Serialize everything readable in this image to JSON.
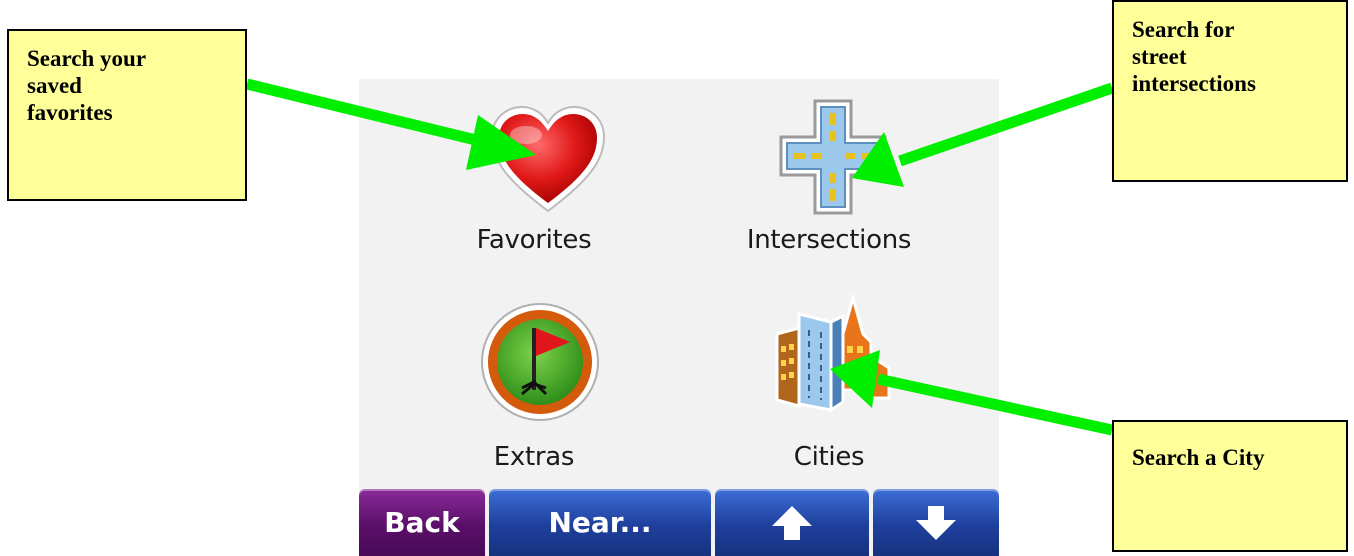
{
  "screen": {
    "tiles": [
      {
        "label": "Favorites",
        "icon": "heart-icon"
      },
      {
        "label": "Intersections",
        "icon": "intersection-icon"
      },
      {
        "label": "Extras",
        "icon": "flag-icon"
      },
      {
        "label": "Cities",
        "icon": "city-buildings-icon"
      }
    ],
    "bottom_bar": {
      "back_label": "Back",
      "near_label": "Near...",
      "up_icon": "arrow-up-icon",
      "down_icon": "arrow-down-icon"
    }
  },
  "callouts": {
    "favorites": "Search your\nsaved\nfavorites",
    "intersections": "Search for\nstreet\nintersections",
    "cities": "Search a City"
  },
  "colors": {
    "callout_fill": "#ffff99",
    "arrow": "#00ee00",
    "back_button": "#5a0f68",
    "nav_button": "#1e3f9c"
  }
}
